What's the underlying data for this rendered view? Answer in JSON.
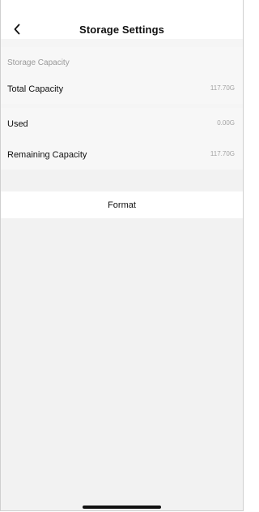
{
  "header": {
    "title": "Storage Settings",
    "back_icon": "chevron-left-icon"
  },
  "storage": {
    "section_label": "Storage Capacity",
    "rows": [
      {
        "label": "Total Capacity",
        "value": "117.70G"
      },
      {
        "label": "Used",
        "value": "0.00G"
      },
      {
        "label": "Remaining Capacity",
        "value": "117.70G"
      }
    ]
  },
  "actions": {
    "format_label": "Format"
  },
  "colors": {
    "page_background": "#f2f2f2",
    "row_background": "#f7f7f7",
    "header_background": "#ffffff",
    "primary_text": "#111111",
    "secondary_text": "#9a9a9a",
    "value_text": "#a3a3a3",
    "home_indicator": "#111111"
  }
}
